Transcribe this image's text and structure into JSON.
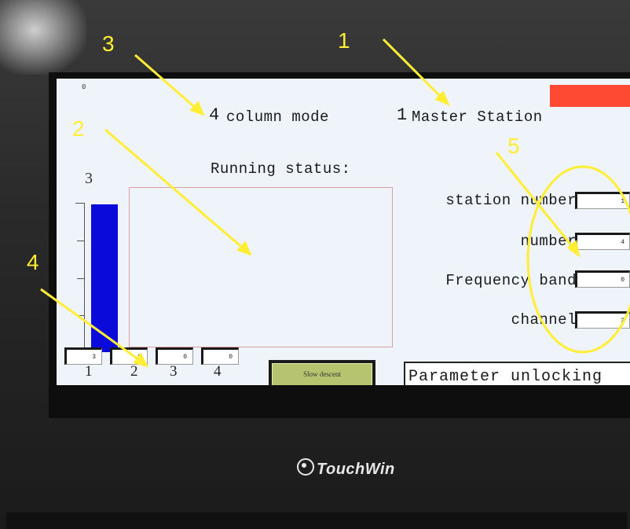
{
  "screen": {
    "tiny_value": "0",
    "mode": {
      "number": "4",
      "label": "column mode"
    },
    "station": {
      "number": "1",
      "label": "Master Station"
    },
    "running_status_label": "Running status:",
    "bar": {
      "max_label": "3",
      "color": "#0a0adb",
      "fill_fraction": 1.0
    },
    "params": [
      {
        "label": "station number",
        "value": "1"
      },
      {
        "label": "number",
        "value": "4"
      },
      {
        "label": "Frequency band",
        "value": "0"
      },
      {
        "label": "channel",
        "value": "3"
      }
    ],
    "columns": [
      {
        "label": "1",
        "value": "3"
      },
      {
        "label": "2",
        "value": "0"
      },
      {
        "label": "3",
        "value": "0"
      },
      {
        "label": "4",
        "value": "0"
      }
    ],
    "slow_descent_label": "Slow descent",
    "unlock_label": "Parameter unlocking",
    "indicator_color": "#ff4a33"
  },
  "device": {
    "brand": "TouchWin"
  },
  "annotations": [
    "1",
    "2",
    "3",
    "4",
    "5"
  ],
  "annotation_color": "#ffee33"
}
